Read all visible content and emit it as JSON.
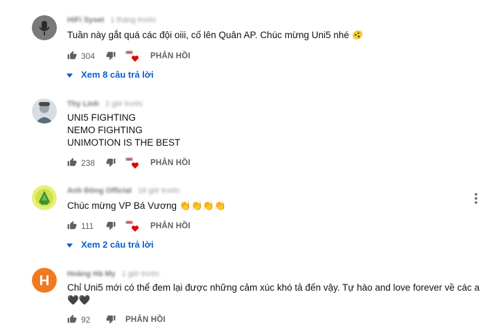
{
  "action_labels": {
    "reply": "PHẢN HỒI"
  },
  "comments": [
    {
      "author": "HiFi Syset",
      "time": "1 tháng trước",
      "lines": [
        "Tuần này gắt quá các đội oiii, cố lên Quân AP. Chúc mừng Uni5 nhé 🫨"
      ],
      "likes": "304",
      "replies_label": "Xem 8 câu trả lời"
    },
    {
      "author": "Thy Linh",
      "time": "2 giờ trước",
      "lines": [
        "UNI5 FIGHTING",
        "NEMO FIGHTING",
        "UNIMOTION IS THE BEST"
      ],
      "likes": "238"
    },
    {
      "author": "Anh Đông Official",
      "time": "16 giờ trước",
      "lines": [
        "Chúc mừng VP Bá Vương 👏👏👏👏"
      ],
      "likes": "111",
      "replies_label": "Xem 2 câu trả lời"
    },
    {
      "author": "Hoàng Hà My",
      "time": "1 giờ trước",
      "lines": [
        "Chỉ Uni5 mới có thể đem lại được những cảm xúc khó tả đến vậy. Tự hào and love forever về các a",
        "🖤🖤"
      ],
      "likes": "92"
    }
  ]
}
